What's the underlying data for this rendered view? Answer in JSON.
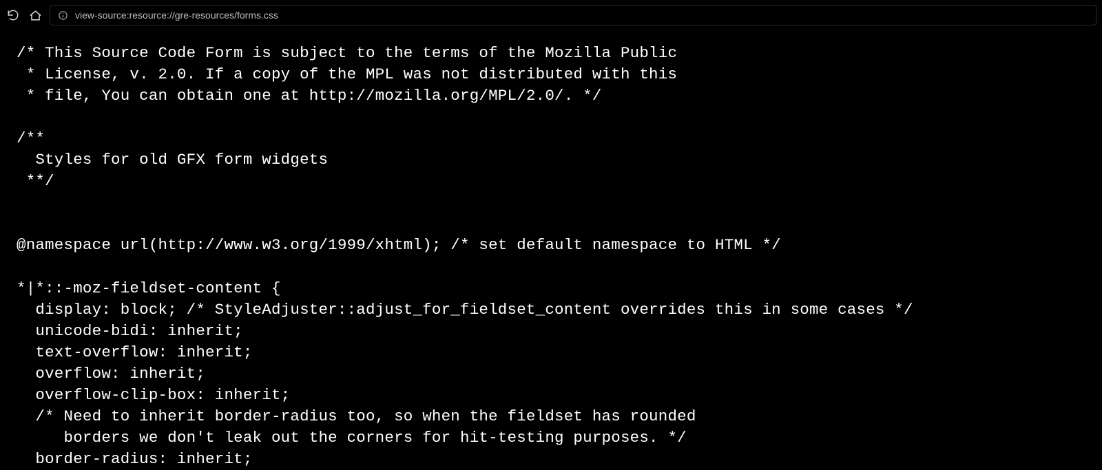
{
  "toolbar": {
    "url": "view-source:resource://gre-resources/forms.css"
  },
  "source": {
    "lines": [
      "/* This Source Code Form is subject to the terms of the Mozilla Public",
      " * License, v. 2.0. If a copy of the MPL was not distributed with this",
      " * file, You can obtain one at http://mozilla.org/MPL/2.0/. */",
      "",
      "/**",
      "  Styles for old GFX form widgets",
      " **/",
      "",
      "",
      "@namespace url(http://www.w3.org/1999/xhtml); /* set default namespace to HTML */",
      "",
      "*|*::-moz-fieldset-content {",
      "  display: block; /* StyleAdjuster::adjust_for_fieldset_content overrides this in some cases */",
      "  unicode-bidi: inherit;",
      "  text-overflow: inherit;",
      "  overflow: inherit;",
      "  overflow-clip-box: inherit;",
      "  /* Need to inherit border-radius too, so when the fieldset has rounded",
      "     borders we don't leak out the corners for hit-testing purposes. */",
      "  border-radius: inherit;"
    ]
  }
}
